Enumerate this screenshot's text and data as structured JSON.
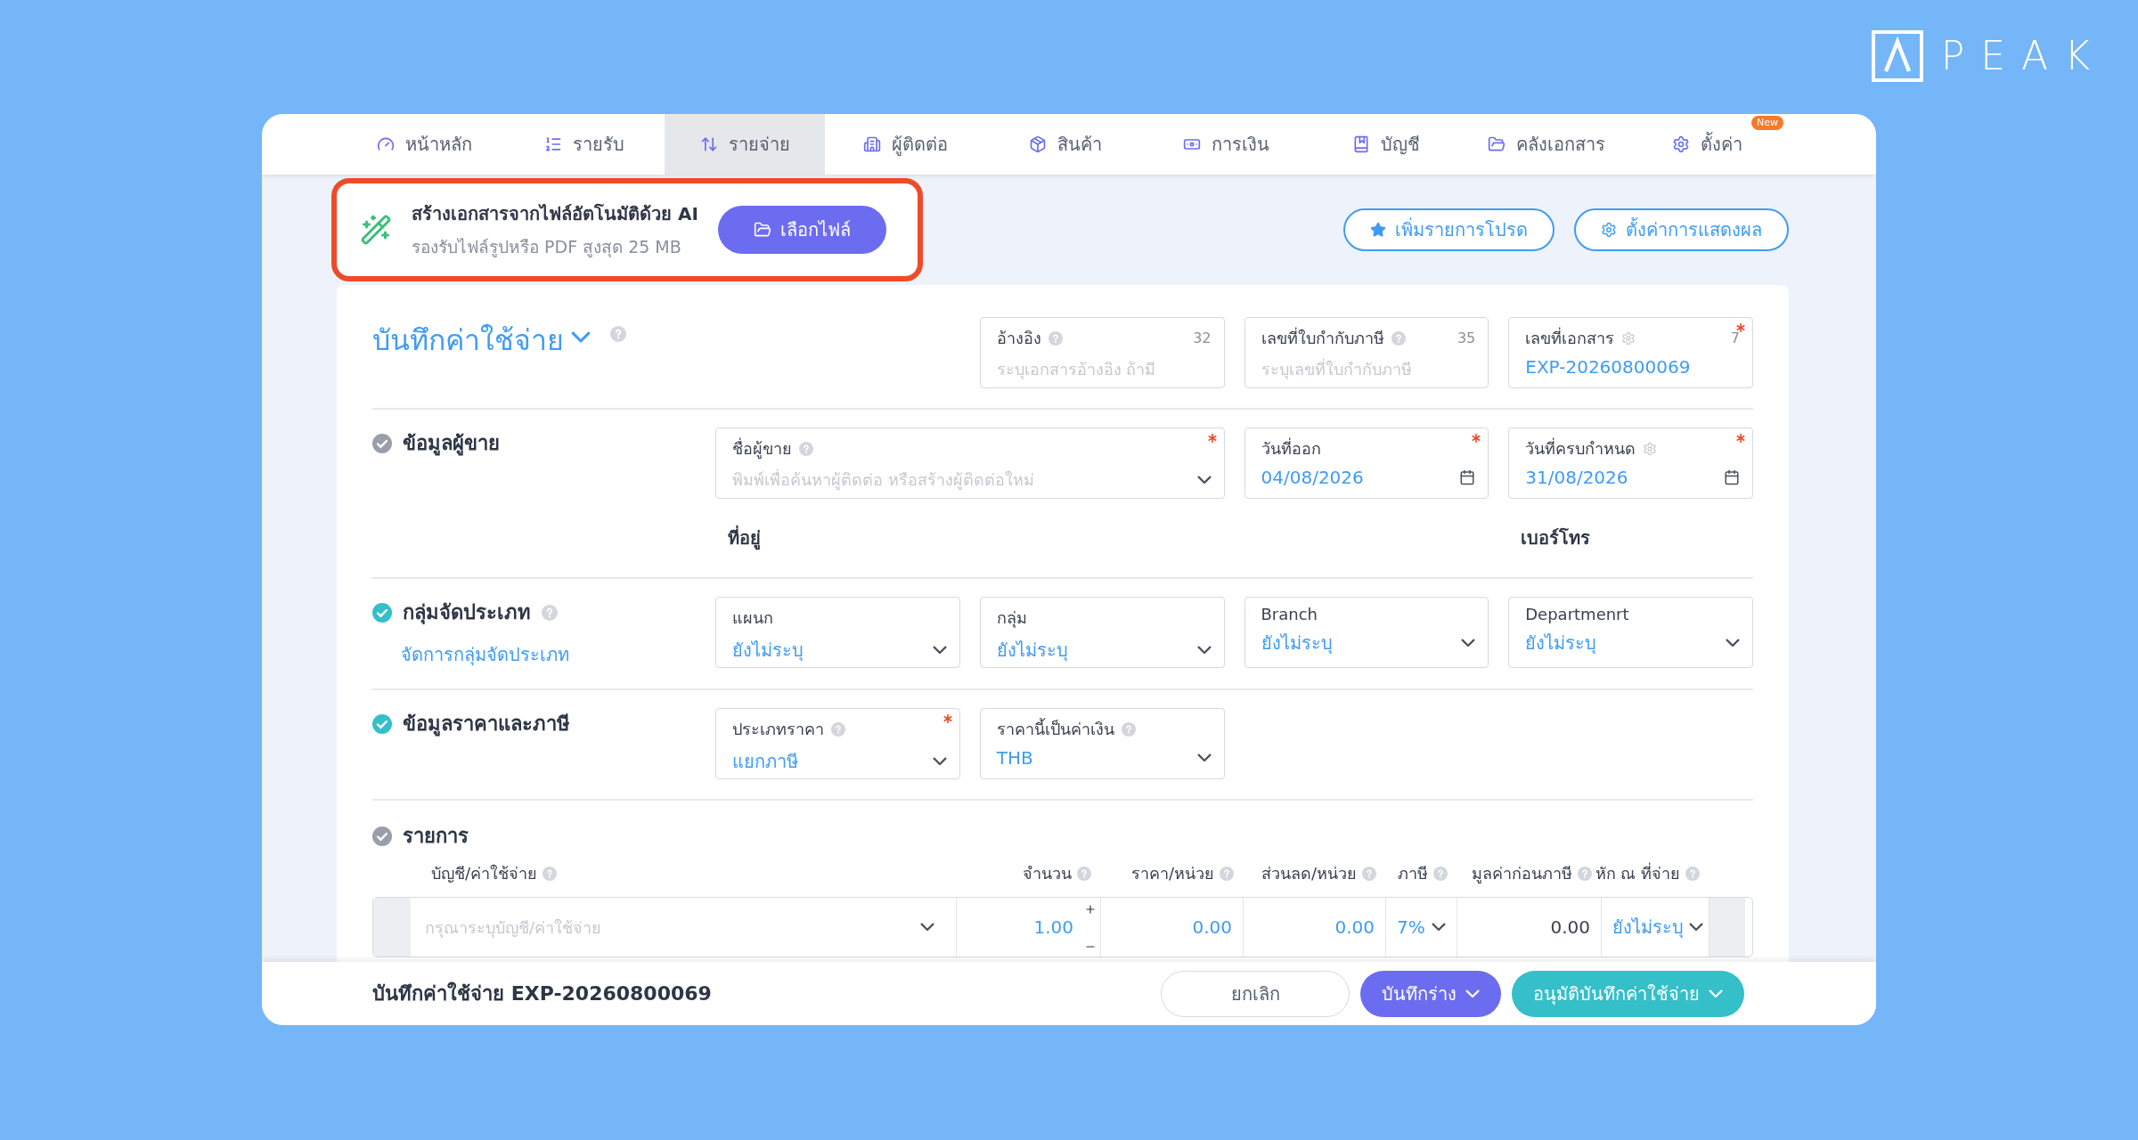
{
  "logo": {
    "text": "PEAK"
  },
  "nav": {
    "tabs": [
      {
        "label": "หน้าหลัก",
        "selected": false
      },
      {
        "label": "รายรับ",
        "selected": false
      },
      {
        "label": "รายจ่าย",
        "selected": true
      },
      {
        "label": "ผู้ติดต่อ",
        "selected": false
      },
      {
        "label": "สินค้า",
        "selected": false
      },
      {
        "label": "การเงิน",
        "selected": false
      },
      {
        "label": "บัญชี",
        "selected": false
      },
      {
        "label": "คลังเอกสาร",
        "selected": false
      },
      {
        "label": "ตั้งค่า",
        "selected": false,
        "badge": "New"
      }
    ]
  },
  "ai_import": {
    "title": "สร้างเอกสารจากไฟล์อัตโนมัติด้วย AI",
    "subtitle": "รองรับไฟล์รูปหรือ PDF สูงสุด 25 MB",
    "button": "เลือกไฟล์",
    "highlighted": true
  },
  "toolbar_buttons": [
    {
      "label": "เพิ่มรายการโปรด",
      "kind": "star"
    },
    {
      "label": "ตั้งค่าการแสดงผล",
      "kind": "gear"
    }
  ],
  "document": {
    "title": "บันทึกค่าใช้จ่าย",
    "header_fields": [
      {
        "kind": "text",
        "label": "อ้างอิง",
        "help": true,
        "counter": "32",
        "placeholder": "ระบุเอกสารอ้างอิง ถ้ามี",
        "required": false
      },
      {
        "kind": "text",
        "label": "เลขที่ใบกำกับภาษี",
        "help": true,
        "counter": "35",
        "placeholder": "ระบุเลขที่ใบกำกับภาษี",
        "required": false
      },
      {
        "kind": "text",
        "label": "เลขที่เอกสาร",
        "gear": true,
        "counter": "7",
        "value": "EXP-20260800069",
        "required": true
      }
    ]
  },
  "sections": [
    {
      "kind": "vendor",
      "title": "ข้อมูลผู้ขาย",
      "completed": false,
      "fields": [
        {
          "kind": "combo",
          "label": "ชื่อผู้ขาย",
          "help": true,
          "placeholder": "พิมพ์เพื่อค้นหาผู้ติดต่อ หรือสร้างผู้ติดต่อใหม่",
          "required": true
        },
        {
          "kind": "date",
          "label": "วันที่ออก",
          "value": "04/08/2026",
          "required": true
        },
        {
          "kind": "date",
          "label": "วันที่ครบกำหนด",
          "gear": true,
          "value": "31/08/2026",
          "required": true
        }
      ],
      "address_label": "ที่อยู่",
      "phone_label": "เบอร์โทร"
    },
    {
      "kind": "classification",
      "title": "กลุ่มจัดประเภท",
      "help": true,
      "completed": true,
      "link": "จัดการกลุ่มจัดประเภท",
      "fields": [
        {
          "kind": "select",
          "label": "แผนก",
          "value": "ยังไม่ระบุ",
          "required": false
        },
        {
          "kind": "select",
          "label": "กลุ่ม",
          "value": "ยังไม่ระบุ",
          "required": false
        },
        {
          "kind": "select",
          "label": "Branch",
          "value": "ยังไม่ระบุ",
          "required": false
        },
        {
          "kind": "select",
          "label": "Departmenrt",
          "value": "ยังไม่ระบุ",
          "required": false
        }
      ]
    },
    {
      "kind": "price",
      "title": "ข้อมูลราคาและภาษี",
      "completed": true,
      "fields": [
        {
          "kind": "select",
          "label": "ประเภทราคา",
          "help": true,
          "value": "แยกภาษี",
          "required": true
        },
        {
          "kind": "select",
          "label": "ราคานี้เป็นค่าเงิน",
          "help": true,
          "value": "THB",
          "required": false
        }
      ]
    }
  ],
  "items": {
    "title": "รายการ",
    "completed": false,
    "columns": [
      {
        "label": "บัญชี/ค่าใช้จ่าย",
        "help": true
      },
      {
        "label": "จำนวน",
        "help": true
      },
      {
        "label": "ราคา/หน่วย",
        "help": true
      },
      {
        "label": "ส่วนลด/หน่วย",
        "help": true
      },
      {
        "label": "ภาษี",
        "help": true
      },
      {
        "label": "มูลค่าก่อนภาษี",
        "help": true
      },
      {
        "label": "หัก ณ ที่จ่าย",
        "help": true
      }
    ],
    "rows": [
      {
        "cells": [
          {
            "kind": "select",
            "placeholder": "กรุณาระบุบัญชี/ค่าใช้จ่าย"
          },
          {
            "kind": "stepper",
            "value": "1.00"
          },
          {
            "kind": "input",
            "value": "0.00"
          },
          {
            "kind": "input",
            "value": "0.00"
          },
          {
            "kind": "select",
            "value": "7%"
          },
          {
            "kind": "static",
            "value": "0.00"
          },
          {
            "kind": "select",
            "value": "ยังไม่ระบุ"
          }
        ]
      }
    ]
  },
  "footer": {
    "title": "บันทึกค่าใช้จ่าย EXP-20260800069",
    "buttons": [
      {
        "label": "ยกเลิก",
        "kind": "cancel"
      },
      {
        "label": "บันทึกร่าง",
        "kind": "draft"
      },
      {
        "label": "อนุมัติบันทึกค่าใช้จ่าย",
        "kind": "approve"
      }
    ]
  }
}
